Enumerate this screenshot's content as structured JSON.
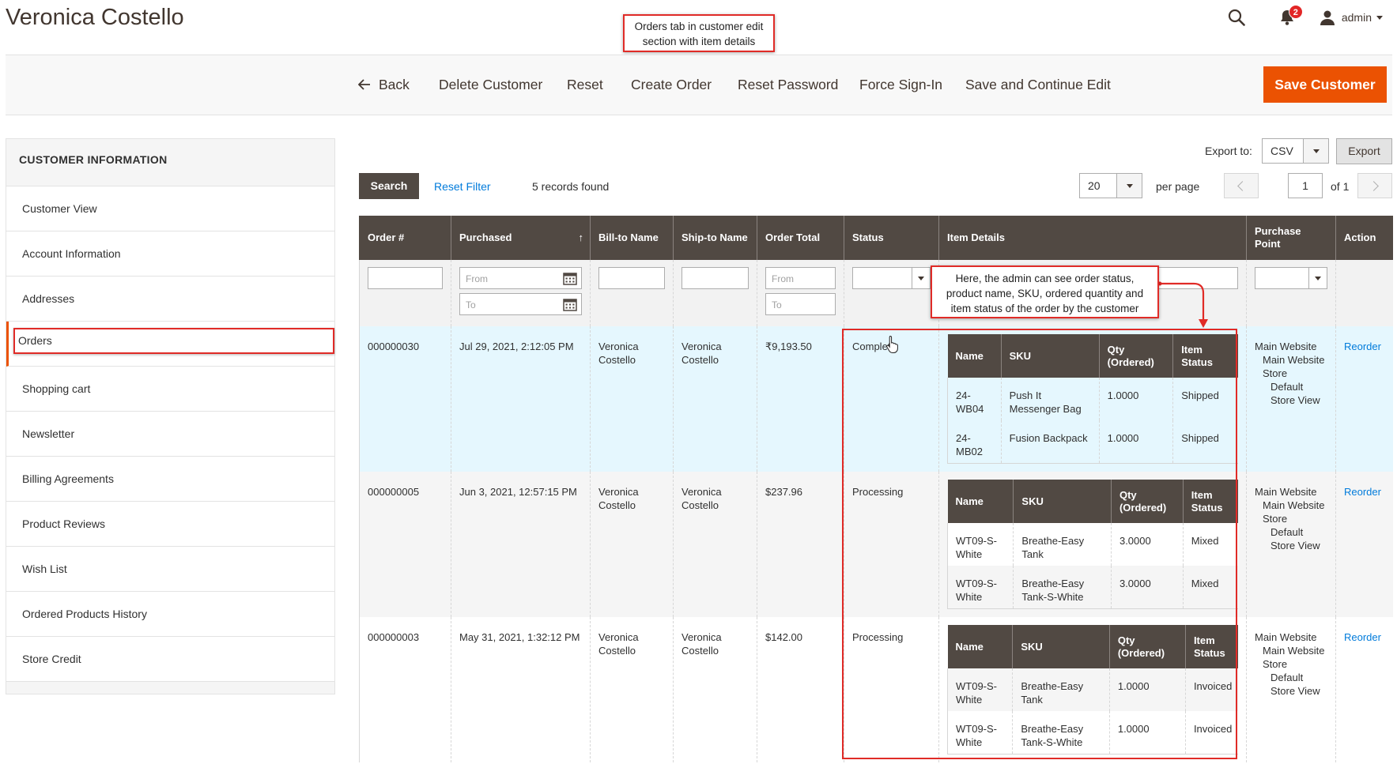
{
  "page": {
    "title": "Veronica Costello"
  },
  "annotations": {
    "top_callout": [
      "Orders tab in customer edit",
      "section with item details"
    ],
    "grid_callout": [
      "Here, the admin can see order status,",
      "product name, SKU, ordered quantity and",
      "item status of the order by the customer"
    ]
  },
  "header": {
    "notifications_count": "2",
    "user": "admin"
  },
  "toolbar": {
    "back": "Back",
    "delete": "Delete Customer",
    "reset": "Reset",
    "create_order": "Create Order",
    "reset_password": "Reset Password",
    "force_signin": "Force Sign-In",
    "save_continue": "Save and Continue Edit",
    "save": "Save Customer"
  },
  "sidebar": {
    "title": "CUSTOMER INFORMATION",
    "items": [
      {
        "label": "Customer View"
      },
      {
        "label": "Account Information"
      },
      {
        "label": "Addresses"
      },
      {
        "label": "Orders",
        "active": true
      },
      {
        "label": "Shopping cart"
      },
      {
        "label": "Newsletter"
      },
      {
        "label": "Billing Agreements"
      },
      {
        "label": "Product Reviews"
      },
      {
        "label": "Wish List"
      },
      {
        "label": "Ordered Products History"
      },
      {
        "label": "Store Credit"
      }
    ]
  },
  "grid_controls": {
    "export_label": "Export to:",
    "export_format": "CSV",
    "export_button": "Export",
    "search_button": "Search",
    "reset_filter": "Reset Filter",
    "records_found": "5 records found",
    "per_page_value": "20",
    "per_page_label": "per page",
    "page_current": "1",
    "page_total": "of 1"
  },
  "grid": {
    "columns": [
      "Order #",
      "Purchased",
      "Bill-to Name",
      "Ship-to Name",
      "Order Total",
      "Status",
      "Item Details",
      "Purchase Point",
      "Action"
    ],
    "sorted_column": "Purchased",
    "sort_arrow": "↑",
    "filters": {
      "from": "From",
      "to": "To"
    },
    "item_columns": [
      "Name",
      "SKU",
      "Qty (Ordered)",
      "Item Status"
    ],
    "rows": [
      {
        "order": "000000030",
        "purchased": "Jul 29, 2021, 2:12:05 PM",
        "bill_to": "Veronica Costello",
        "ship_to": "Veronica Costello",
        "total": "₹9,193.50",
        "status": "Complete",
        "items": [
          {
            "name": "24-WB04",
            "sku": "Push It Messenger Bag",
            "qty": "1.0000",
            "status": "Shipped"
          },
          {
            "name": "24-MB02",
            "sku": "Fusion Backpack",
            "qty": "1.0000",
            "status": "Shipped"
          }
        ],
        "purchase_point": [
          "Main Website",
          "Main Website Store",
          "Default Store View"
        ],
        "action": "Reorder"
      },
      {
        "order": "000000005",
        "purchased": "Jun 3, 2021, 12:57:15 PM",
        "bill_to": "Veronica Costello",
        "ship_to": "Veronica Costello",
        "total": "$237.96",
        "status": "Processing",
        "items": [
          {
            "name": "WT09-S-White",
            "sku": "Breathe-Easy Tank",
            "qty": "3.0000",
            "status": "Mixed"
          },
          {
            "name": "WT09-S-White",
            "sku": "Breathe-Easy Tank-S-White",
            "qty": "3.0000",
            "status": "Mixed"
          }
        ],
        "purchase_point": [
          "Main Website",
          "Main Website Store",
          "Default Store View"
        ],
        "action": "Reorder"
      },
      {
        "order": "000000003",
        "purchased": "May 31, 2021, 1:32:12 PM",
        "bill_to": "Veronica Costello",
        "ship_to": "Veronica Costello",
        "total": "$142.00",
        "status": "Processing",
        "items": [
          {
            "name": "WT09-S-White",
            "sku": "Breathe-Easy Tank",
            "qty": "1.0000",
            "status": "Invoiced"
          },
          {
            "name": "WT09-S-White",
            "sku": "Breathe-Easy Tank-S-White",
            "qty": "1.0000",
            "status": "Invoiced"
          }
        ],
        "purchase_point": [
          "Main Website",
          "Main Website Store",
          "Default Store View"
        ],
        "action": "Reorder"
      }
    ]
  },
  "colors": {
    "accent": "#eb5202",
    "header_dark": "#514943",
    "link": "#007bdb",
    "annotation": "#e02b27",
    "row_highlight": "#e5f7fe"
  }
}
